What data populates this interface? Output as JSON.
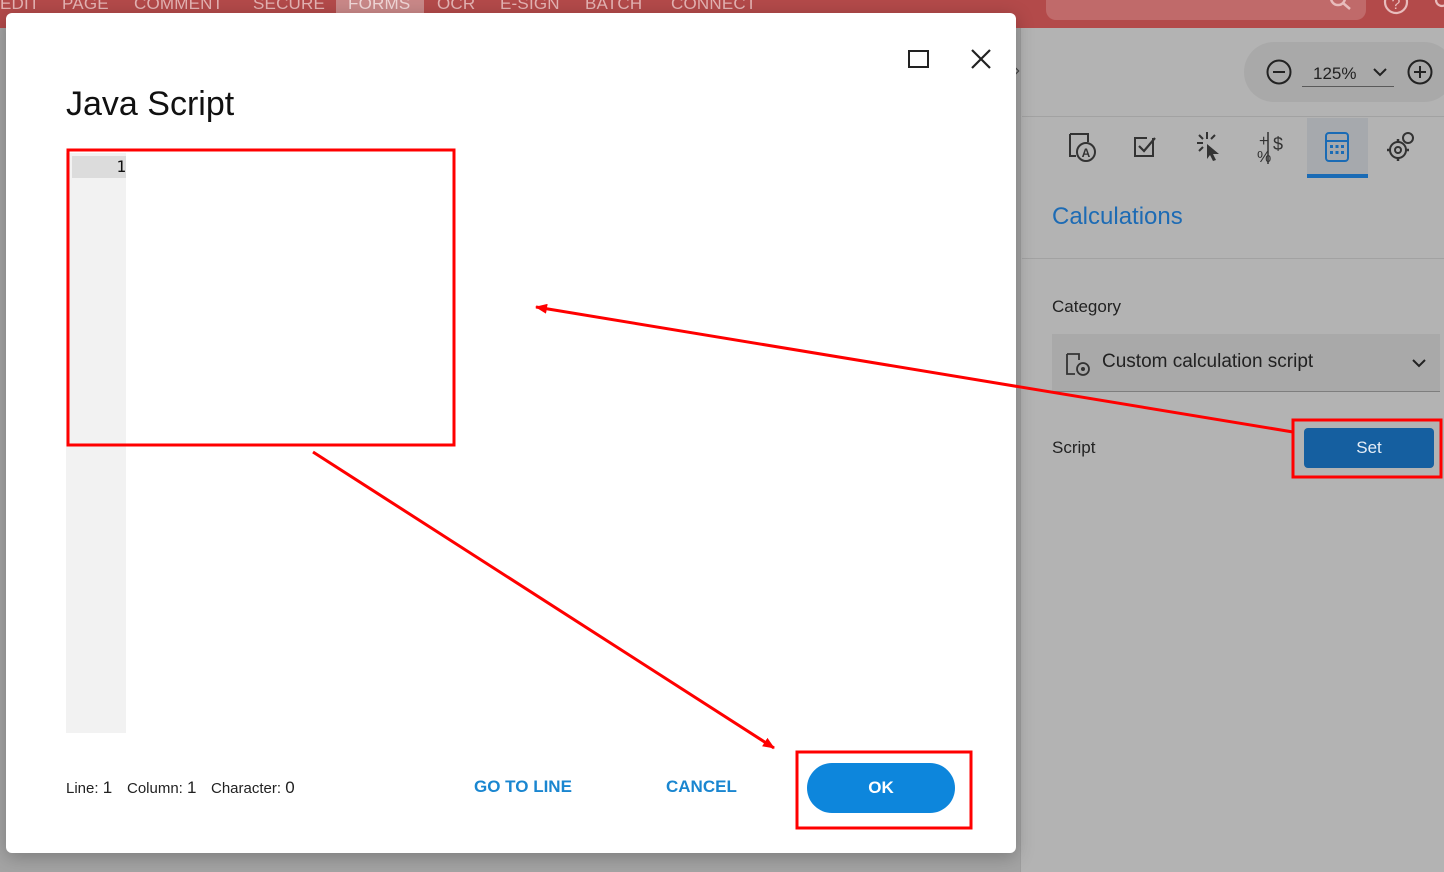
{
  "app": {
    "menu": [
      "EDIT",
      "PAGE",
      "COMMENT",
      "SECURE",
      "FORMS",
      "OCR",
      "E-SIGN",
      "BATCH",
      "CONNECT"
    ],
    "active_menu": "FORMS",
    "zoom": "125%"
  },
  "panel": {
    "title": "Calculations",
    "category_label": "Category",
    "category_value": "Custom calculation script",
    "script_label": "Script",
    "set_label": "Set"
  },
  "dialog": {
    "title": "Java Script",
    "line_number": "1",
    "status": {
      "line_label": "Line:",
      "line_value": "1",
      "column_label": "Column:",
      "column_value": "1",
      "char_label": "Character:",
      "char_value": "0"
    },
    "goto_label": "GO TO LINE",
    "cancel_label": "CANCEL",
    "ok_label": "OK"
  },
  "colors": {
    "brand_red": "#b34a4a",
    "primary_blue": "#0d86dc",
    "annotation_red": "#ff0000"
  },
  "icons": [
    "search-icon",
    "help-icon",
    "user-icon",
    "maximize-icon",
    "close-icon",
    "zoom-out-icon",
    "zoom-in-icon",
    "chevron-down-icon",
    "text-field-icon",
    "checkbox-icon",
    "action-icon",
    "format-icon",
    "calculator-icon",
    "settings-icon",
    "script-settings-icon"
  ]
}
